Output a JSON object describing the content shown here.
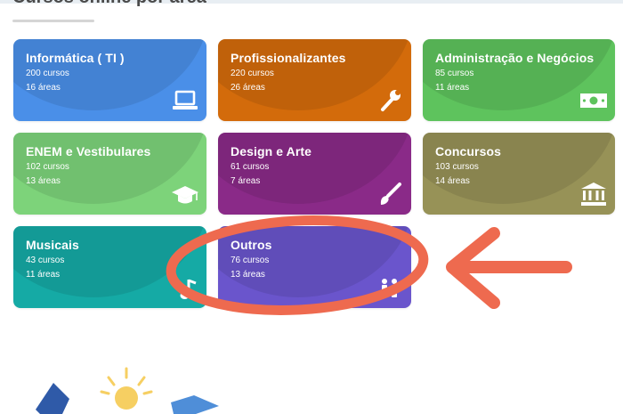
{
  "section": {
    "title": "Cursos online por área"
  },
  "categories": [
    {
      "name": "Informática ( TI )",
      "courses": "200 cursos",
      "areas": "16 áreas",
      "icon": "laptop-icon"
    },
    {
      "name": "Profissionalizantes",
      "courses": "220 cursos",
      "areas": "26 áreas",
      "icon": "wrench-icon"
    },
    {
      "name": "Administração e Negócios",
      "courses": "85 cursos",
      "areas": "11 áreas",
      "icon": "money-icon"
    },
    {
      "name": "ENEM e Vestibulares",
      "courses": "102 cursos",
      "areas": "13 áreas",
      "icon": "graduation-cap-icon"
    },
    {
      "name": "Design e Arte",
      "courses": "61 cursos",
      "areas": "7 áreas",
      "icon": "paintbrush-icon"
    },
    {
      "name": "Concursos",
      "courses": "103 cursos",
      "areas": "14 áreas",
      "icon": "institution-icon"
    },
    {
      "name": "Musicais",
      "courses": "43 cursos",
      "areas": "11 áreas",
      "icon": "music-note-icon"
    },
    {
      "name": "Outros",
      "courses": "76 cursos",
      "areas": "13 áreas",
      "icon": "people-icon"
    }
  ],
  "colors": {
    "informatica": "#4a8fe8",
    "profissionalizantes": "#d36b0b",
    "administracao": "#5ec35d",
    "enem": "#7dd37a",
    "design": "#8a2a88",
    "concursos": "#979257",
    "musicais": "#15aaa5",
    "outros": "#6a55cc",
    "annotation": "#ee6a4f"
  }
}
